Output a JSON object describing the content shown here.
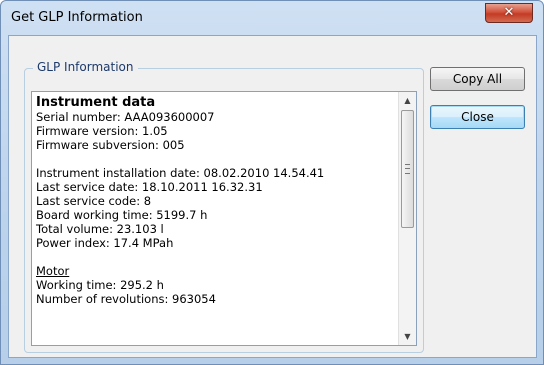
{
  "window": {
    "title": "Get GLP Information",
    "close_glyph": "✕"
  },
  "group": {
    "title": "GLP Information"
  },
  "info": {
    "heading": "Instrument data",
    "serial": "Serial number: AAA093600007",
    "firmware_version": "Firmware version: 1.05",
    "firmware_subversion": "Firmware subversion: 005",
    "install_date": "Instrument installation date: 08.02.2010 14.54.41",
    "last_service_date": "Last service date: 18.10.2011 16.32.31",
    "last_service_code": "Last service code: 8",
    "board_time": "Board working time: 5199.7 h",
    "total_volume": "Total volume: 23.103 l",
    "power_index": "Power index: 17.4 MPah",
    "motor_heading": "Motor",
    "motor_working_time": "Working time: 295.2 h",
    "motor_revolutions": "Number of revolutions: 963054"
  },
  "buttons": {
    "copy_all": "Copy All",
    "close": "Close"
  },
  "scrollbar": {
    "up_glyph": "▲",
    "down_glyph": "▼"
  },
  "icons": [
    "close-icon",
    "scroll-up-arrow-icon",
    "scroll-down-arrow-icon",
    "scroll-grip-icon"
  ]
}
